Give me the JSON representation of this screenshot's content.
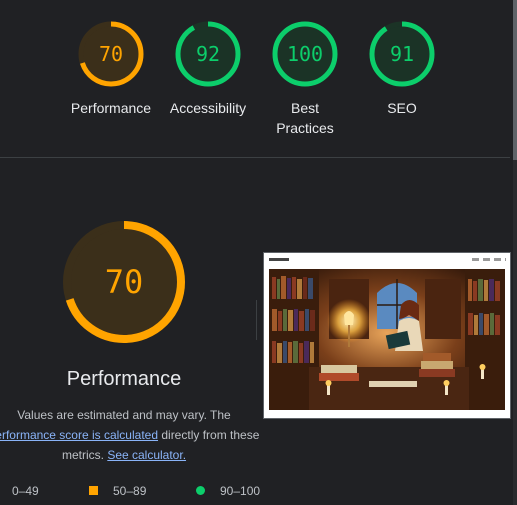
{
  "gauges": [
    {
      "label": "Performance",
      "score": "70",
      "value": 70,
      "color": "#ffa400",
      "bg": "#3b2f1a"
    },
    {
      "label": "Accessibility",
      "score": "92",
      "value": 92,
      "color": "#0cce6b",
      "bg": "#1b3326"
    },
    {
      "label": "Best\nPractices",
      "score": "100",
      "value": 100,
      "color": "#0cce6b",
      "bg": "#1b3326"
    },
    {
      "label": "SEO",
      "score": "91",
      "value": 91,
      "color": "#0cce6b",
      "bg": "#1b3326"
    }
  ],
  "performance": {
    "score": "70",
    "value": 70,
    "title": "Performance",
    "desc_prefix": "Values are estimated and may vary. The ",
    "link_score": "performance score is calculated",
    "desc_middle": " directly from these metrics. ",
    "link_calculator": "See calculator."
  },
  "legend": [
    {
      "range": "0–49",
      "color": "#ff4e42",
      "shape": "triangle"
    },
    {
      "range": "50–89",
      "color": "#ffa400",
      "shape": "square"
    },
    {
      "range": "90–100",
      "color": "#0cce6b",
      "shape": "circle"
    }
  ],
  "colors": {
    "background": "#202124",
    "average": "#ffa400",
    "pass": "#0cce6b",
    "link": "#8ab4f8"
  }
}
